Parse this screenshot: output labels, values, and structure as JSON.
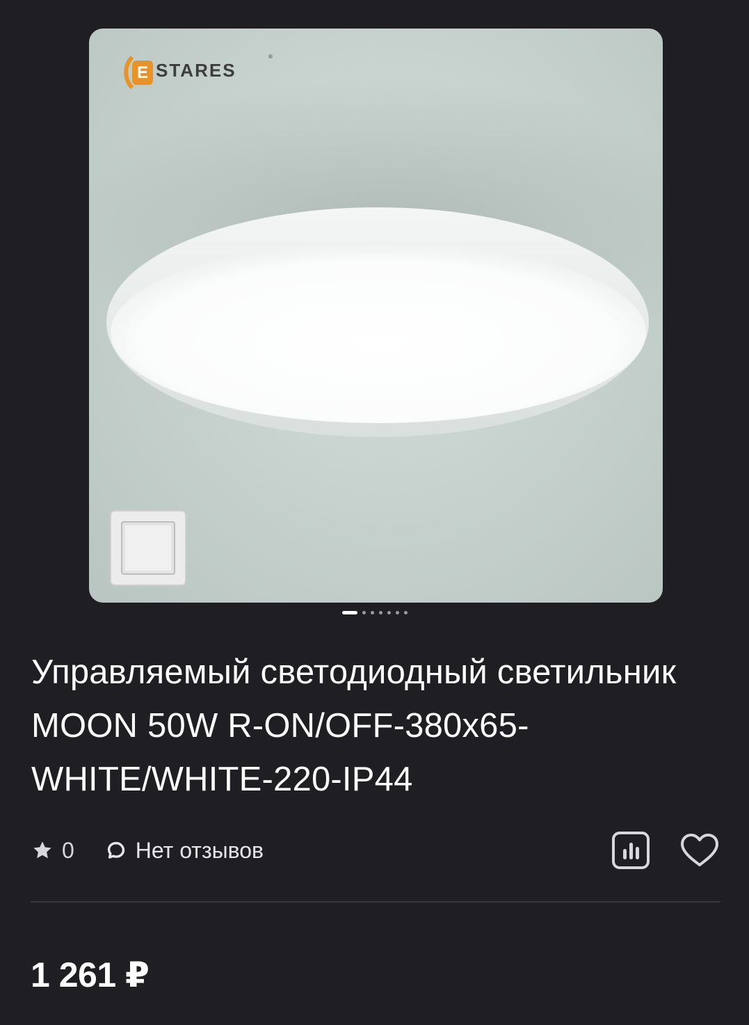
{
  "product": {
    "brand_logo_text": "STARES",
    "title": "Управляемый светодиодный светильник MOON 50W R-ON/OFF-380x65-WHITE/WHITE-220-IP44",
    "rating_value": "0",
    "reviews_label": "Нет отзывов",
    "price": "1 261 ₽"
  },
  "gallery": {
    "image_count": 7,
    "active_index": 0
  },
  "icons": {
    "rating": "star-icon",
    "reviews": "chat-bubble-icon",
    "compare": "bar-chart-icon",
    "favorite": "heart-icon"
  },
  "colors": {
    "background": "#1f1f23",
    "text": "#ffffff",
    "muted_text": "#d8d8dc",
    "logo_orange": "#e8922a",
    "divider": "#38383e"
  }
}
